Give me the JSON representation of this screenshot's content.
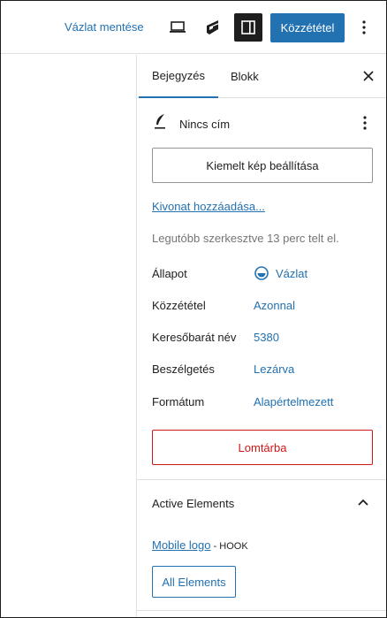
{
  "toolbar": {
    "save_draft_label": "Vázlat mentése",
    "publish_label": "Közzététel",
    "icons": [
      "desktop-preview-icon",
      "generatepress-icon",
      "sidebar-toggle-icon",
      "more-vertical-icon"
    ]
  },
  "sidebar": {
    "tabs": [
      {
        "label": "Bejegyzés",
        "active": true
      },
      {
        "label": "Blokk",
        "active": false
      }
    ],
    "post_title": "Nincs cím",
    "featured_image_label": "Kiemelt kép beállítása",
    "excerpt_link": "Kivonat hozzáadása...",
    "last_edited": "Legutóbb szerkesztve 13 perc telt el.",
    "meta": [
      {
        "label": "Állapot",
        "value": "Vázlat"
      },
      {
        "label": "Közzététel",
        "value": "Azonnal"
      },
      {
        "label": "Keresőbarát név",
        "value": "5380"
      },
      {
        "label": "Beszélgetés",
        "value": "Lezárva"
      },
      {
        "label": "Formátum",
        "value": "Alapértelmezett"
      }
    ],
    "trash_label": "Lomtárba",
    "active_elements": {
      "title": "Active Elements",
      "item_link": "Mobile logo",
      "item_tag": " - HOOK",
      "all_button": "All Elements"
    }
  },
  "colors": {
    "accent": "#2271b1",
    "danger": "#cc1818",
    "muted": "#757575",
    "border": "#e0e0e0"
  }
}
